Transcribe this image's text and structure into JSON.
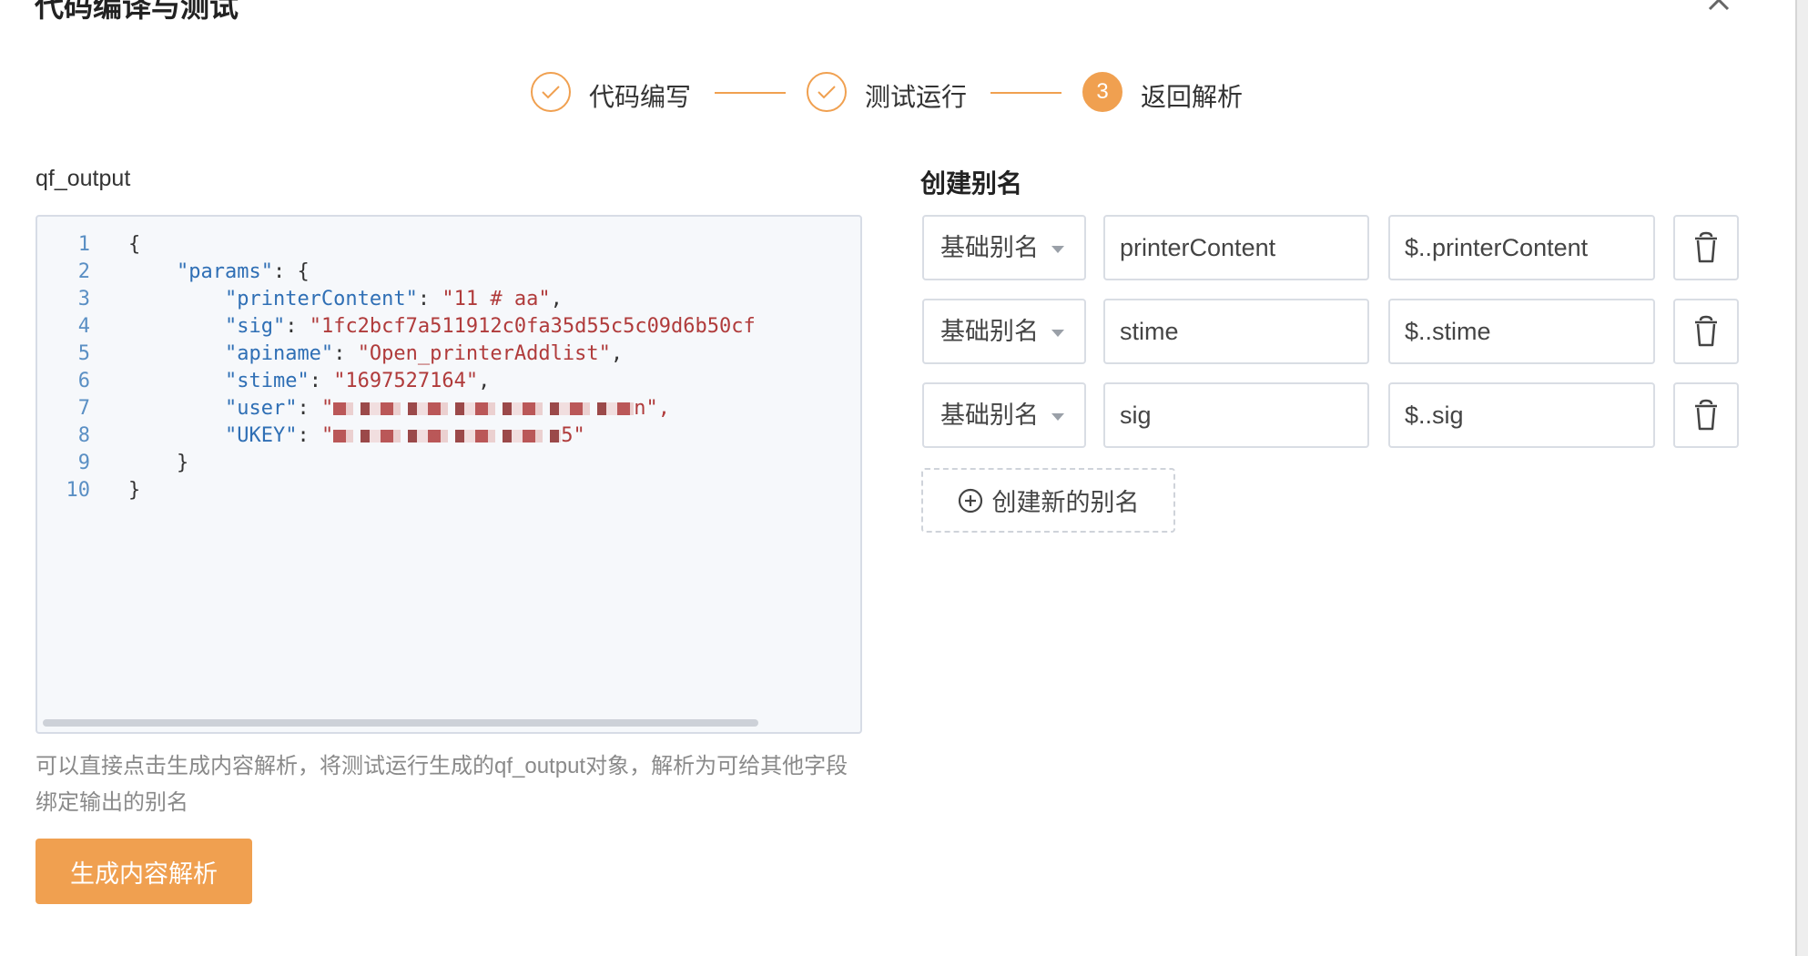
{
  "modal": {
    "title": "代码编译与测试"
  },
  "steps": [
    {
      "label": "代码编写",
      "state": "done"
    },
    {
      "label": "测试运行",
      "state": "done"
    },
    {
      "label": "返回解析",
      "state": "active",
      "number": "3"
    }
  ],
  "code_panel": {
    "title": "qf_output",
    "lines": [
      {
        "no": "1",
        "indent": "",
        "key": "",
        "sep": "",
        "value": "",
        "tail": "{"
      },
      {
        "no": "2",
        "indent": "    ",
        "key": "\"params\"",
        "sep": ": ",
        "value": "",
        "tail": "{"
      },
      {
        "no": "3",
        "indent": "        ",
        "key": "\"printerContent\"",
        "sep": ": ",
        "value": "\"11 # aa\"",
        "tail": ","
      },
      {
        "no": "4",
        "indent": "        ",
        "key": "\"sig\"",
        "sep": ": ",
        "value": "\"1fc2bcf7a511912c0fa35d55c5c09d6b50cf",
        "tail": ""
      },
      {
        "no": "5",
        "indent": "        ",
        "key": "\"apiname\"",
        "sep": ": ",
        "value": "\"Open_printerAddlist\"",
        "tail": ","
      },
      {
        "no": "6",
        "indent": "        ",
        "key": "\"stime\"",
        "sep": ": ",
        "value": "\"1697527164\"",
        "tail": ","
      },
      {
        "no": "7",
        "indent": "        ",
        "key": "\"user\"",
        "sep": ": ",
        "value": "\"",
        "tail": "n\",",
        "redacted": true
      },
      {
        "no": "8",
        "indent": "        ",
        "key": "\"UKEY\"",
        "sep": ": ",
        "value": "\"",
        "tail": "5\"",
        "redacted": true
      },
      {
        "no": "9",
        "indent": "    ",
        "key": "",
        "sep": "",
        "value": "",
        "tail": "}"
      },
      {
        "no": "10",
        "indent": "",
        "key": "",
        "sep": "",
        "value": "",
        "tail": "}"
      }
    ]
  },
  "hint_text": "可以直接点击生成内容解析，将测试运行生成的qf_output对象，解析为可给其他字段绑定输出的别名",
  "generate_button": "生成内容解析",
  "alias_panel": {
    "title": "创建别名",
    "rows": [
      {
        "type": "基础别名",
        "name": "printerContent",
        "path": "$..printerContent"
      },
      {
        "type": "基础别名",
        "name": "stime",
        "path": "$..stime"
      },
      {
        "type": "基础别名",
        "name": "sig",
        "path": "$..sig"
      }
    ],
    "add_button": "创建新的别名"
  },
  "colors": {
    "accent": "#f0a050",
    "key": "#2f6fb5",
    "string": "#b03b3b",
    "line_number": "#5a8fc4"
  }
}
